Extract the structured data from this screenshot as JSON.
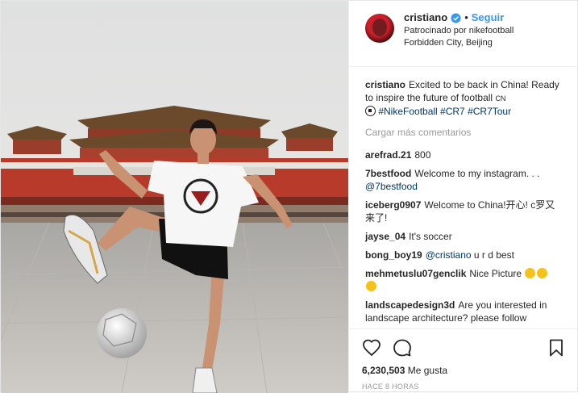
{
  "header": {
    "username": "cristiano",
    "follow_label": "Seguir",
    "separator": "•",
    "sponsored_prefix": "Patrocinado por ",
    "sponsor": "nikefootball",
    "location": "Forbidden City, Beijing"
  },
  "caption": {
    "user": "cristiano",
    "text": "Excited to be back in China! Ready to inspire the future of football ",
    "flag": "CN",
    "hashtags": "#NikeFootball #CR7 #CR7Tour"
  },
  "load_more_label": "Cargar más comentarios",
  "comments": [
    {
      "user": "arefrad.21",
      "text": "800"
    },
    {
      "user": "7bestfood",
      "text": "Welcome to my instagram. . . ",
      "link": "@7bestfood"
    },
    {
      "user": "iceberg0907",
      "text": "Welcome to China!开心! c罗又来了!"
    },
    {
      "user": "jayse_04",
      "text": "It's soccer"
    },
    {
      "user": "bong_boy19",
      "text": " u r d best",
      "link": "@cristiano"
    },
    {
      "user": "mehmetuslu07genclik",
      "text": "Nice Picture"
    },
    {
      "user": "landscapedesign3d",
      "text": "Are you interested in landscape architecture? please follow"
    }
  ],
  "likes": {
    "count": "6,230,503",
    "label": " Me gusta"
  },
  "timestamp": "HACE 8 HORAS",
  "colors": {
    "accent": "#3897f0",
    "link": "#003569",
    "muted": "#999999",
    "wall": "#b83a2a"
  },
  "icons": [
    "verified-badge-icon",
    "heart-icon",
    "comment-icon",
    "bookmark-icon",
    "soccer-ball-emoji-icon",
    "thumbs-up-emoji-icon"
  ]
}
